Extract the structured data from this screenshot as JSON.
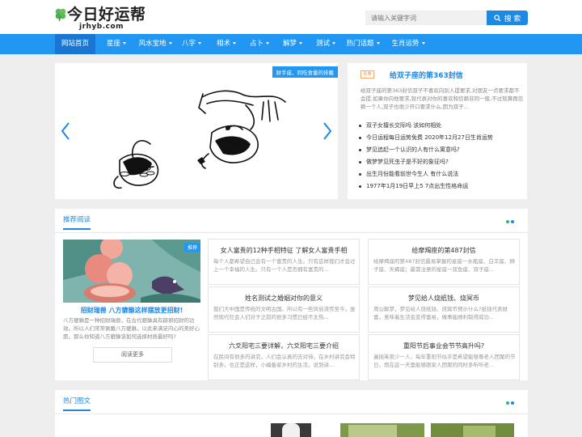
{
  "site": {
    "logo_text": "今日好运帮",
    "logo_domain": "jrhyb.com"
  },
  "search": {
    "placeholder": "请输入关键字词",
    "button_label": "搜 索"
  },
  "nav": {
    "items": [
      {
        "label": "网站首页",
        "dropdown": false,
        "active": true
      },
      {
        "label": "星座",
        "dropdown": true
      },
      {
        "label": "风水宝地",
        "dropdown": true
      },
      {
        "label": "八字",
        "dropdown": true
      },
      {
        "label": "相术",
        "dropdown": true
      },
      {
        "label": "占卜",
        "dropdown": true
      },
      {
        "label": "解梦",
        "dropdown": true
      },
      {
        "label": "测试",
        "dropdown": true
      },
      {
        "label": "热门话题",
        "dropdown": true
      },
      {
        "label": "生肖运势",
        "dropdown": true
      }
    ]
  },
  "slider": {
    "tag": "财手座，同吃食量的排戴",
    "prev_icon": "chevron-left-icon",
    "next_icon": "chevron-right-icon"
  },
  "featured": {
    "tag": "头条",
    "title": "给双子座的第363封信",
    "summary": "给双子座的第363封信双子不喜欢向别人提要求,对朋友一点要求都不会提,如果你向他要求,就代表对你的喜欢和信赖非同一般,不过就算再信赖一个人,双子也很少开口要求什么,因为双子...",
    "list": [
      "双子女擅长交际吗 该如何相处",
      "今日运程每日运势免费 2020年12月27日生肖运势",
      "梦见追赶一个认识的人有什么寓意吗?",
      "做梦梦见死虫子是不好的象征吗?",
      "出生月份能看前世今生人 有什么说法",
      "1977年1月19日早上5 7点出生性格命运"
    ]
  },
  "recommended": {
    "heading": "推荐阅读",
    "main": {
      "badge": "推荐",
      "title": "招财瑞兽 八方貔貅这样摆放更招财!",
      "summary": "八方貔貅是一种招财瑞兽，在古代貔貅具有辟邪招财的功效。所以人们常常佩戴八方貔貅，以此来满足内心的美好心愿。那么你知道八方貔貅该如何选择材质最好吗?",
      "more_label": "阅读更多"
    },
    "cards": [
      {
        "title": "女人富贵的12种手相特征 了解女人富贵手相",
        "summary": "每个人都希望自己会有一个富贵的人生。只有这样我们才会过上一个幸福的人生。只有一个人是否拥有富贵的..."
      },
      {
        "title": "给摩羯座的第487封信",
        "summary": "给摩羯座的第487封信最易掌握的星座一水瓶座、白羊座、狮子座、天蝎座；最需注意的星座一双鱼座、双子座..."
      },
      {
        "title": "姓名测试之婚姻对你的意义",
        "summary": "我们大中国是传统的文明古国。所以有一些风俗流传至今。虽然现代社会人们对于之前的很多习惯已经不太热..."
      },
      {
        "title": "梦见给人烧纸钱、烧冥币",
        "summary": "周公解梦，梦见给人烧纸钱、烧冥币预示什么?纸钱代表财富，意味着生活会变得富裕，做事能顺利取得成功..."
      },
      {
        "title": "六爻阳宅三要详解，六爻阳宅三要介绍",
        "summary": "在民间有很多的讲究，人们会认真的去对待，在乡村讲究会特别多，也正是这样，小编备家乡村的生活，说到讲..."
      },
      {
        "title": "重阳节后事业会节节高升吗?",
        "summary": "遍插茱萸少一人，每年重阳节似乎是希望能够尊老人团聚的节日，而在这一天里能够跟家人团聚的同时多听听老..."
      }
    ]
  },
  "hot": {
    "heading": "热门图文"
  },
  "colors": {
    "brand_blue": "#2196f3",
    "nav_active": "#1976d2",
    "link_blue": "#1e88e5",
    "dot_green": "#2bb673",
    "dot_blue": "#1e88e5",
    "tag_orange": "#f08a3c"
  }
}
